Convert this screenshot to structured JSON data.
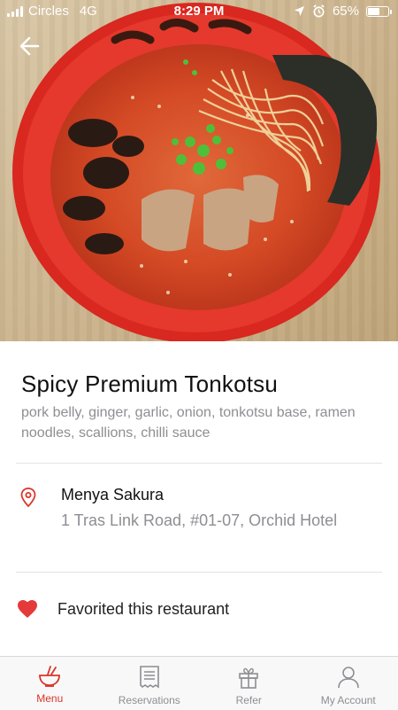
{
  "status_bar": {
    "carrier": "Circles",
    "network": "4G",
    "time": "8:29 PM",
    "battery_text": "65%",
    "battery_level": 0.65
  },
  "colors": {
    "accent": "#d9352b",
    "text_primary": "#111111",
    "text_secondary": "#8e8e93",
    "divider": "#e2e2e2"
  },
  "header": {
    "back_icon": "arrow-left-icon"
  },
  "dish": {
    "name": "Spicy Premium Tonkotsu",
    "ingredients": "pork belly, ginger, garlic, onion, tonkotsu base, ramen noodles, scallions, chilli sauce"
  },
  "restaurant": {
    "icon": "location-pin-icon",
    "name": "Menya Sakura",
    "address": "1 Tras Link Road, #01-07, Orchid Hotel"
  },
  "favorite": {
    "icon": "heart-icon",
    "label": "Favorited this restaurant"
  },
  "tabs": [
    {
      "label": "Menu",
      "icon": "ramen-bowl-icon",
      "active": true
    },
    {
      "label": "Reservations",
      "icon": "receipt-icon",
      "active": false
    },
    {
      "label": "Refer",
      "icon": "gift-icon",
      "active": false
    },
    {
      "label": "My Account",
      "icon": "user-icon",
      "active": false
    }
  ]
}
